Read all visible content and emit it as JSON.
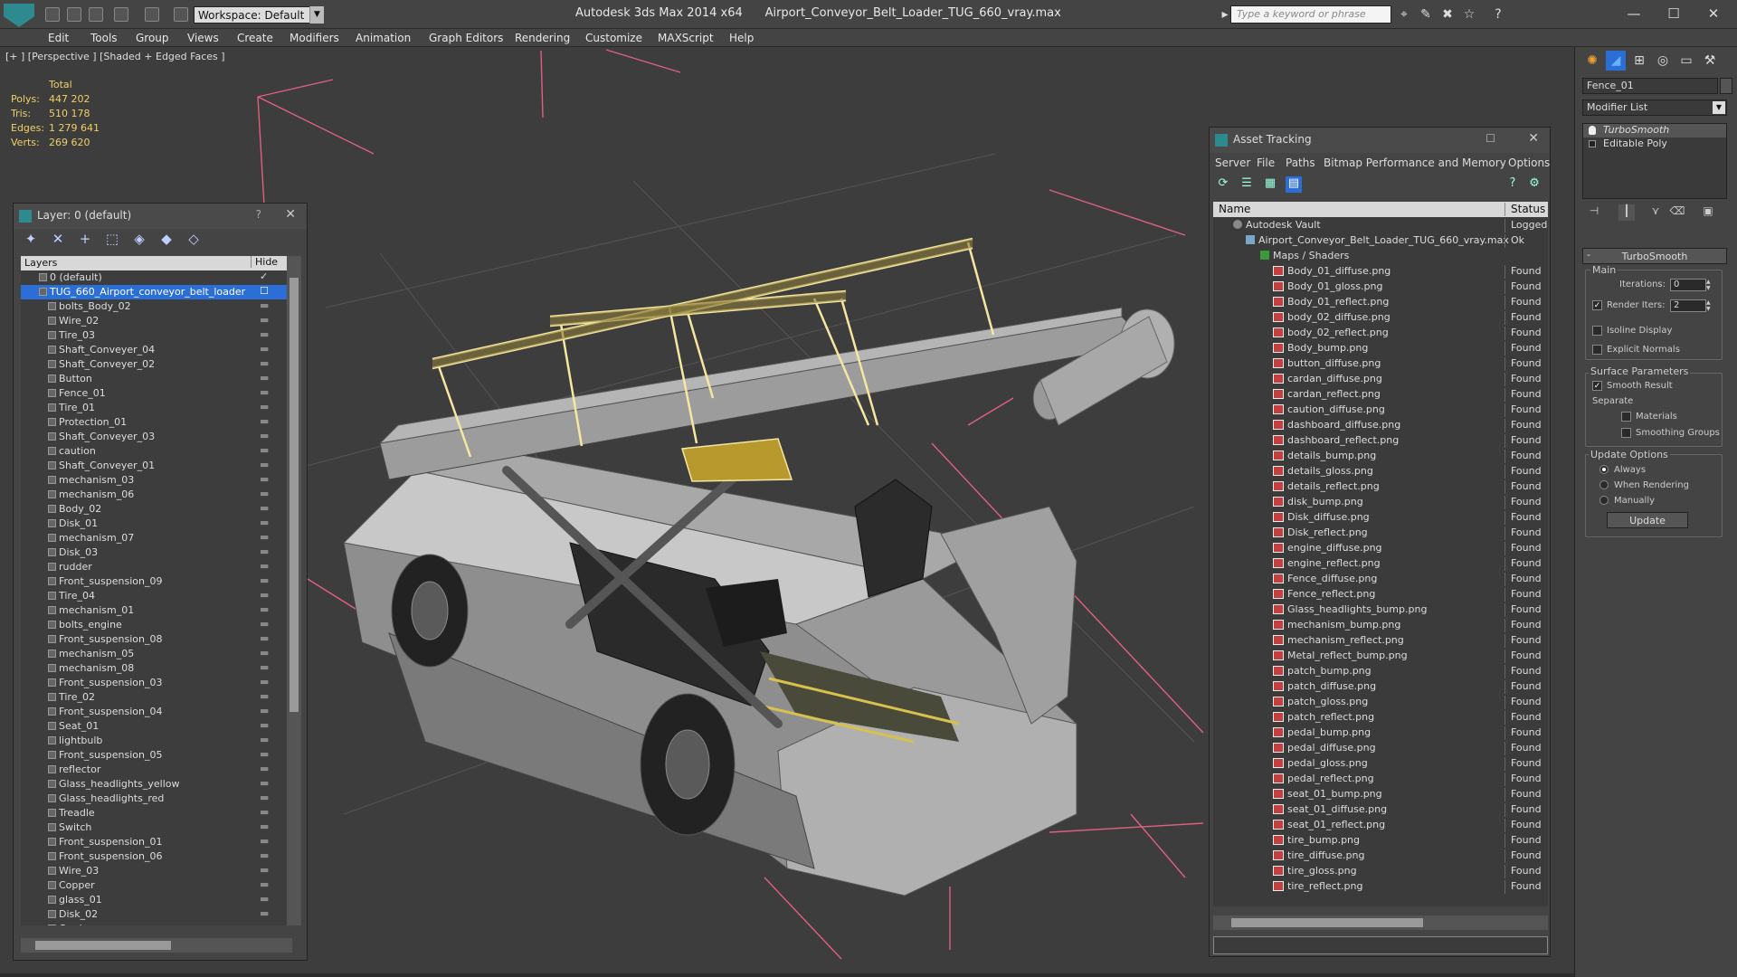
{
  "titlebar": {
    "workspace_label": "Workspace: Default",
    "app_name": "Autodesk 3ds Max 2014 x64",
    "file_name": "Airport_Conveyor_Belt_Loader_TUG_660_vray.max",
    "search_placeholder": "Type a keyword or phrase",
    "minimize": "—",
    "maximize": "☐",
    "close": "✕"
  },
  "menubar": {
    "items": [
      "Edit",
      "Tools",
      "Group",
      "Views",
      "Create",
      "Modifiers",
      "Animation",
      "Graph Editors",
      "Rendering",
      "Customize",
      "MAXScript",
      "Help"
    ]
  },
  "viewport": {
    "label": "[+ ] [Perspective ] [Shaded + Edged Faces ]",
    "stats_title": "Total",
    "stats": [
      {
        "key": "Polys:",
        "value": "447 202"
      },
      {
        "key": "Tris:",
        "value": "510 178"
      },
      {
        "key": "Edges:",
        "value": "1 279 641"
      },
      {
        "key": "Verts:",
        "value": "269 620"
      }
    ]
  },
  "layer_panel": {
    "title": "Layer: 0 (default)",
    "help": "?",
    "close": "✕",
    "col_layers": "Layers",
    "col_hide": "Hide",
    "top_items": [
      "0 (default)",
      "TUG_660_Airport_conveyor_belt_loader"
    ],
    "objects": [
      "bolts_Body_02",
      "Wire_02",
      "Tire_03",
      "Shaft_Conveyer_04",
      "Shaft_Conveyer_02",
      "Button",
      "Fence_01",
      "Tire_01",
      "Protection_01",
      "Shaft_Conveyer_03",
      "caution",
      "Shaft_Conveyer_01",
      "mechanism_03",
      "mechanism_06",
      "Body_02",
      "Disk_01",
      "mechanism_07",
      "Disk_03",
      "rudder",
      "Front_suspension_09",
      "Tire_04",
      "mechanism_01",
      "bolts_engine",
      "Front_suspension_08",
      "mechanism_05",
      "mechanism_08",
      "Front_suspension_03",
      "Tire_02",
      "Front_suspension_04",
      "Seat_01",
      "lightbulb",
      "Front_suspension_05",
      "reflector",
      "Glass_headlights_yellow",
      "Glass_headlights_red",
      "Treadle",
      "Switch",
      "Front_suspension_01",
      "Front_suspension_06",
      "Wire_03",
      "Copper",
      "glass_01",
      "Disk_02",
      "Cardan"
    ]
  },
  "asset_panel": {
    "title": "Asset Tracking",
    "menu": [
      "Server",
      "File",
      "Paths",
      "Bitmap Performance and Memory",
      "Options"
    ],
    "col_name": "Name",
    "col_status": "Status",
    "vault": {
      "name": "Autodesk Vault",
      "status": "Logged"
    },
    "file": {
      "name": "Airport_Conveyor_Belt_Loader_TUG_660_vray.max",
      "status": "Ok"
    },
    "maps_group": "Maps / Shaders",
    "maps": [
      {
        "name": "Body_01_diffuse.png",
        "status": "Found"
      },
      {
        "name": "Body_01_gloss.png",
        "status": "Found"
      },
      {
        "name": "Body_01_reflect.png",
        "status": "Found"
      },
      {
        "name": "body_02_diffuse.png",
        "status": "Found"
      },
      {
        "name": "body_02_reflect.png",
        "status": "Found"
      },
      {
        "name": "Body_bump.png",
        "status": "Found"
      },
      {
        "name": "button_diffuse.png",
        "status": "Found"
      },
      {
        "name": "cardan_diffuse.png",
        "status": "Found"
      },
      {
        "name": "cardan_reflect.png",
        "status": "Found"
      },
      {
        "name": "caution_diffuse.png",
        "status": "Found"
      },
      {
        "name": "dashboard_diffuse.png",
        "status": "Found"
      },
      {
        "name": "dashboard_reflect.png",
        "status": "Found"
      },
      {
        "name": "details_bump.png",
        "status": "Found"
      },
      {
        "name": "details_gloss.png",
        "status": "Found"
      },
      {
        "name": "details_reflect.png",
        "status": "Found"
      },
      {
        "name": "disk_bump.png",
        "status": "Found"
      },
      {
        "name": "Disk_diffuse.png",
        "status": "Found"
      },
      {
        "name": "Disk_reflect.png",
        "status": "Found"
      },
      {
        "name": "engine_diffuse.png",
        "status": "Found"
      },
      {
        "name": "engine_reflect.png",
        "status": "Found"
      },
      {
        "name": "Fence_diffuse.png",
        "status": "Found"
      },
      {
        "name": "Fence_reflect.png",
        "status": "Found"
      },
      {
        "name": "Glass_headlights_bump.png",
        "status": "Found"
      },
      {
        "name": "mechanism_bump.png",
        "status": "Found"
      },
      {
        "name": "mechanism_reflect.png",
        "status": "Found"
      },
      {
        "name": "Metal_reflect_bump.png",
        "status": "Found"
      },
      {
        "name": "patch_bump.png",
        "status": "Found"
      },
      {
        "name": "patch_diffuse.png",
        "status": "Found"
      },
      {
        "name": "patch_gloss.png",
        "status": "Found"
      },
      {
        "name": "patch_reflect.png",
        "status": "Found"
      },
      {
        "name": "pedal_bump.png",
        "status": "Found"
      },
      {
        "name": "pedal_diffuse.png",
        "status": "Found"
      },
      {
        "name": "pedal_gloss.png",
        "status": "Found"
      },
      {
        "name": "pedal_reflect.png",
        "status": "Found"
      },
      {
        "name": "seat_01_bump.png",
        "status": "Found"
      },
      {
        "name": "seat_01_diffuse.png",
        "status": "Found"
      },
      {
        "name": "seat_01_reflect.png",
        "status": "Found"
      },
      {
        "name": "tire_bump.png",
        "status": "Found"
      },
      {
        "name": "tire_diffuse.png",
        "status": "Found"
      },
      {
        "name": "tire_gloss.png",
        "status": "Found"
      },
      {
        "name": "tire_reflect.png",
        "status": "Found"
      }
    ]
  },
  "command_panel": {
    "object_name": "Fence_01",
    "modifier_list": "Modifier List",
    "stack": [
      "TurboSmooth",
      "Editable Poly"
    ],
    "rollout_title": "TurboSmooth",
    "main_label": "Main",
    "iterations_label": "Iterations:",
    "iterations_value": "0",
    "render_iters_label": "Render Iters:",
    "render_iters_value": "2",
    "isoline_label": "Isoline Display",
    "explicit_normals_label": "Explicit Normals",
    "surface_params_label": "Surface Parameters",
    "smooth_result_label": "Smooth Result",
    "separate_label": "Separate",
    "materials_label": "Materials",
    "smoothing_groups_label": "Smoothing Groups",
    "update_options_label": "Update Options",
    "always_label": "Always",
    "when_rendering_label": "When Rendering",
    "manually_label": "Manually",
    "update_button": "Update"
  },
  "colors": {
    "selection": "#2b6fd6",
    "stats_text": "#f0d060",
    "viewport_bg": "#3d3d3d",
    "bounding_box": "#e06080",
    "selected_wire": "#f5e6a0"
  }
}
